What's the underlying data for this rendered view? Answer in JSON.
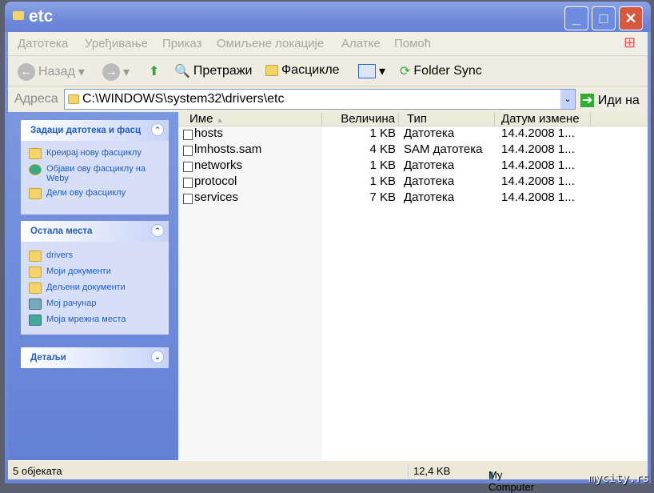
{
  "window": {
    "title": "etc"
  },
  "menu": [
    "Датотека",
    "Уређивање",
    "Приказ",
    "Омиљене локације",
    "Алатке",
    "Помоћ"
  ],
  "toolbar": {
    "back": "Назад",
    "search": "Претражи",
    "folders": "Фасцикле",
    "folder_sync": "Folder Sync"
  },
  "address": {
    "label": "Адреса",
    "value": "C:\\WINDOWS\\system32\\drivers\\etc",
    "go": "Иди на"
  },
  "tasks": {
    "title": "Задаци датотека и фасц",
    "items": [
      "Креирај нову фасциклу",
      "Објави ову фасциклу на Weby",
      "Дели ову фасциклу"
    ]
  },
  "places": {
    "title": "Остала места",
    "items": [
      "drivers",
      "Моји документи",
      "Дељени документи",
      "Мој рачунар",
      "Моја мрежна места"
    ]
  },
  "details": {
    "title": "Детаљи"
  },
  "columns": [
    "Име",
    "Величина",
    "Тип",
    "Датум измене"
  ],
  "files": [
    {
      "name": "hosts",
      "size": "1 KB",
      "type": "Датотека",
      "date": "14.4.2008 1..."
    },
    {
      "name": "lmhosts.sam",
      "size": "4 KB",
      "type": "SAM датотека",
      "date": "14.4.2008 1..."
    },
    {
      "name": "networks",
      "size": "1 KB",
      "type": "Датотека",
      "date": "14.4.2008 1..."
    },
    {
      "name": "protocol",
      "size": "1 KB",
      "type": "Датотека",
      "date": "14.4.2008 1..."
    },
    {
      "name": "services",
      "size": "7 KB",
      "type": "Датотека",
      "date": "14.4.2008 1..."
    }
  ],
  "status": {
    "count": "5 објеката",
    "size": "12,4 KB",
    "zone": "My Computer"
  },
  "watermark": "mycity.rs"
}
